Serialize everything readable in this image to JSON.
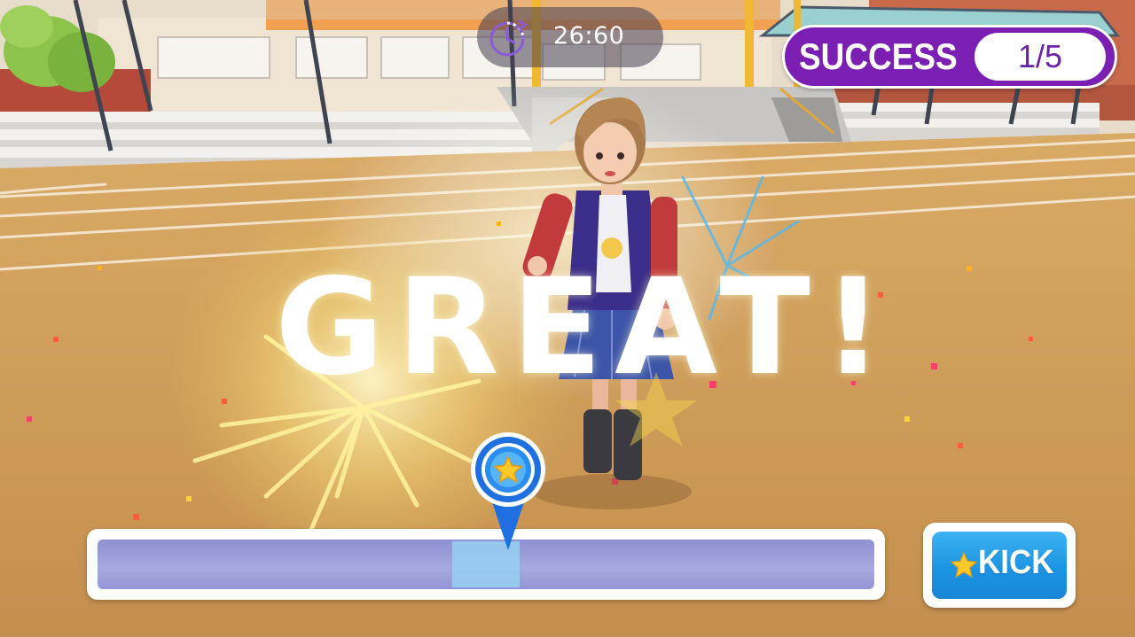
{
  "hud": {
    "timer": {
      "icon": "stopwatch-icon",
      "value": "26:60"
    },
    "success": {
      "label": "SUCCESS",
      "count": "1/5"
    }
  },
  "feedback": {
    "text": "GREAT!"
  },
  "timing_bar": {
    "marker_icon": "star-pin-icon"
  },
  "kick_button": {
    "icon": "star-icon",
    "label": "KICK"
  },
  "colors": {
    "success_purple": "#7a1fb2",
    "kick_blue": "#1b94e3",
    "bar_lavender": "#a7a9e0",
    "marker_blue": "#1e6fe0"
  }
}
